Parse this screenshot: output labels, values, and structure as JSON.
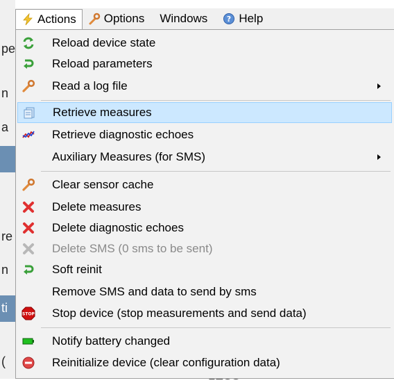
{
  "menubar": {
    "items": [
      {
        "label": "Actions",
        "icon": "lightning-icon"
      },
      {
        "label": "Options",
        "icon": "wrench-icon"
      },
      {
        "label": "Windows",
        "icon": ""
      },
      {
        "label": "Help",
        "icon": "help-icon"
      }
    ]
  },
  "menu": {
    "items": [
      {
        "label": "Reload device state",
        "icon": "refresh-icon"
      },
      {
        "label": "Reload parameters",
        "icon": "reload-arrow-icon"
      },
      {
        "label": "Read a log file",
        "icon": "wrench-icon",
        "submenu": true
      },
      {
        "label": "Retrieve measures",
        "icon": "document-icon",
        "selected": true
      },
      {
        "label": "Retrieve diagnostic echoes",
        "icon": "graph-icon"
      },
      {
        "label": "Auxiliary Measures (for SMS)",
        "icon": "",
        "submenu": true
      },
      {
        "label": "Clear sensor cache",
        "icon": "wrench-icon"
      },
      {
        "label": "Delete measures",
        "icon": "delete-x-icon"
      },
      {
        "label": "Delete diagnostic echoes",
        "icon": "delete-x-icon"
      },
      {
        "label": "Delete SMS (0 sms to be sent)",
        "icon": "delete-x-disabled-icon",
        "disabled": true
      },
      {
        "label": "Soft reinit",
        "icon": "reload-arrow-icon"
      },
      {
        "label": "Remove SMS and data to send by sms",
        "icon": ""
      },
      {
        "label": "Stop device (stop measurements and send data)",
        "icon": "stop-sign-icon"
      },
      {
        "label": "Notify battery changed",
        "icon": "battery-icon"
      },
      {
        "label": "Reinitialize device (clear configuration  data)",
        "icon": "no-entry-icon"
      }
    ],
    "stop_text": "STOP"
  },
  "background": {
    "fragments": [
      "pe",
      "n",
      "a",
      "re",
      "n",
      "ti",
      "( "
    ],
    "bottom_text": "LESS"
  }
}
